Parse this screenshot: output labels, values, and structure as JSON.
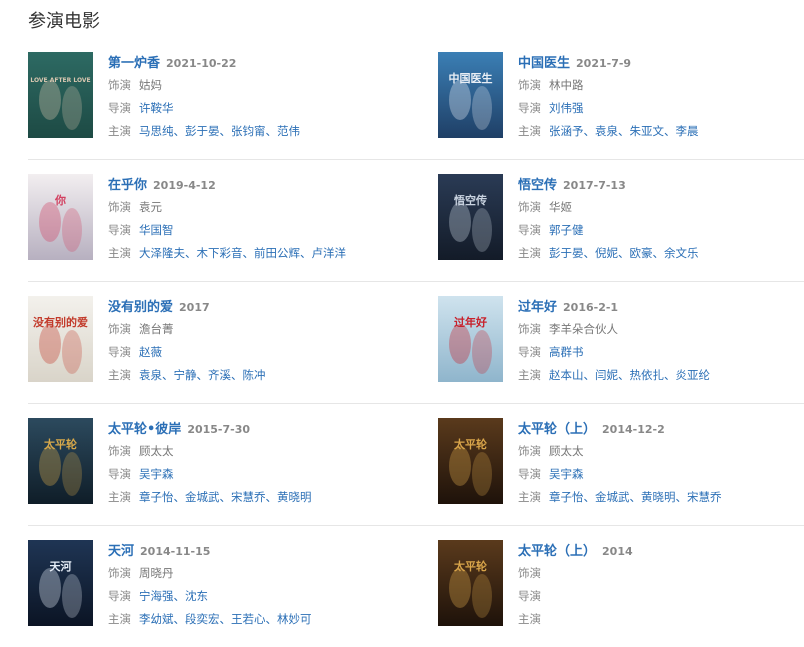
{
  "section_title": "参演电影",
  "labels": {
    "role": "饰演",
    "director": "导演",
    "cast": "主演"
  },
  "colors": {
    "link": "#2b6fb6",
    "label": "#888888",
    "divider": "#e6e6e6"
  },
  "movies": [
    {
      "title": "第一炉香",
      "date": "2021-10-22",
      "role": "姑妈",
      "directors": [
        "许鞍华"
      ],
      "cast": [
        "马思纯",
        "彭于晏",
        "张钧甯",
        "范伟"
      ],
      "poster_text": "LOVE AFTER LOVE",
      "poster_colors": [
        "#2d6a63",
        "#1d4a44",
        "#d8c6b0"
      ]
    },
    {
      "title": "中国医生",
      "date": "2021-7-9",
      "role": "林中路",
      "directors": [
        "刘伟强"
      ],
      "cast": [
        "张涵予",
        "袁泉",
        "朱亚文",
        "李晨"
      ],
      "poster_text": "中国医生",
      "poster_colors": [
        "#3b7fb5",
        "#1f3f66",
        "#e8eef5"
      ]
    },
    {
      "title": "在乎你",
      "date": "2019-4-12",
      "role": "袁元",
      "directors": [
        "华国智"
      ],
      "cast": [
        "大泽隆夫",
        "木下彩音",
        "前田公辉",
        "卢洋洋"
      ],
      "poster_text": "你",
      "poster_colors": [
        "#f2eef0",
        "#b7b0c0",
        "#d24060"
      ]
    },
    {
      "title": "悟空传",
      "date": "2017-7-13",
      "role": "华姬",
      "directors": [
        "郭子健"
      ],
      "cast": [
        "彭于晏",
        "倪妮",
        "欧豪",
        "余文乐"
      ],
      "poster_text": "悟空传",
      "poster_colors": [
        "#2a3b55",
        "#131b28",
        "#c9d3e0"
      ]
    },
    {
      "title": "没有别的爱",
      "date": "2017",
      "role": "澹台菁",
      "directors": [
        "赵薇"
      ],
      "cast": [
        "袁泉",
        "宁静",
        "齐溪",
        "陈冲"
      ],
      "poster_text": "没有别的爱",
      "poster_colors": [
        "#f3f1ec",
        "#d9d4c9",
        "#c23a2a"
      ]
    },
    {
      "title": "过年好",
      "date": "2016-2-1",
      "role": "李羊朵合伙人",
      "directors": [
        "高群书"
      ],
      "cast": [
        "赵本山",
        "闫妮",
        "热依扎",
        "炎亚纶"
      ],
      "poster_text": "过年好",
      "poster_colors": [
        "#cfe3ee",
        "#8fb5cc",
        "#c8202a"
      ]
    },
    {
      "title": "太平轮•彼岸",
      "date": "2015-7-30",
      "role": "顾太太",
      "directors": [
        "吴宇森"
      ],
      "cast": [
        "章子怡",
        "金城武",
        "宋慧乔",
        "黄晓明"
      ],
      "poster_text": "太平轮",
      "poster_colors": [
        "#2c4a5e",
        "#0f1d28",
        "#d8a94a"
      ]
    },
    {
      "title": "太平轮（上）",
      "date": "2014-12-2",
      "role": "顾太太",
      "directors": [
        "吴宇森"
      ],
      "cast": [
        "章子怡",
        "金城武",
        "黄晓明",
        "宋慧乔"
      ],
      "poster_text": "太平轮",
      "poster_colors": [
        "#5a3a1c",
        "#1e120a",
        "#d9a54a"
      ]
    },
    {
      "title": "天河",
      "date": "2014-11-15",
      "role": "周晓丹",
      "directors": [
        "宁海强",
        "沈东"
      ],
      "cast": [
        "李幼斌",
        "段奕宏",
        "王若心",
        "林妙可"
      ],
      "poster_text": "天河",
      "poster_colors": [
        "#1f3554",
        "#0b1424",
        "#e6eef8"
      ]
    },
    {
      "title": "太平轮（上）",
      "date": "2014",
      "role": "",
      "directors": [],
      "cast": [],
      "poster_text": "太平轮",
      "poster_colors": [
        "#5a3a1c",
        "#1e120a",
        "#d9a54a"
      ]
    }
  ]
}
